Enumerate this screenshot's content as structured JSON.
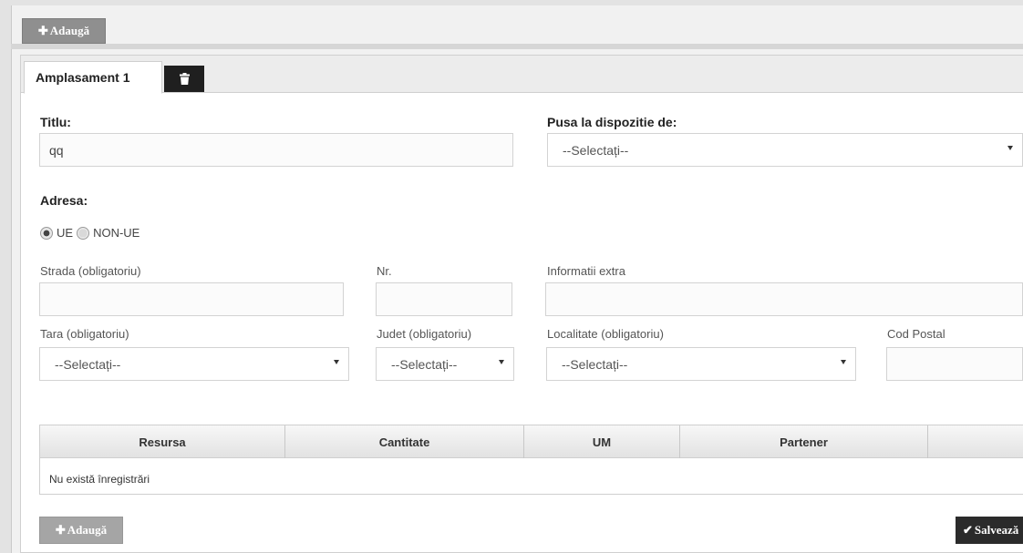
{
  "toolbar": {
    "add_label": "Adaugă"
  },
  "tabs": [
    {
      "label": "Amplasament 1"
    }
  ],
  "form": {
    "titlu_label": "Titlu:",
    "titlu_value": "qq",
    "pusa_label": "Pusa la dispozitie de:",
    "pusa_value": "--Selectați--",
    "adresa_label": "Adresa:",
    "radio_ue": "UE",
    "radio_nonue": "NON-UE",
    "radio_selected": "UE",
    "strada_label": "Strada (obligatoriu)",
    "nr_label": "Nr.",
    "info_label": "Informatii extra",
    "tara_label": "Tara (obligatoriu)",
    "tara_value": "--Selectați--",
    "judet_label": "Judet (obligatoriu)",
    "judet_value": "--Selectați--",
    "localitate_label": "Localitate (obligatoriu)",
    "localitate_value": "--Selectați--",
    "cod_label": "Cod Postal"
  },
  "table": {
    "columns": [
      "Resursa",
      "Cantitate",
      "UM",
      "Partener",
      ""
    ],
    "empty_text": "Nu există înregistrări"
  },
  "footer": {
    "add_label": "Adaugă",
    "save_label": "Salvează"
  },
  "icons": {
    "add": "plus-icon",
    "delete": "trash-icon",
    "save": "check-icon",
    "dropdown": "caret-down-icon"
  },
  "colors": {
    "save_button": "#2b2b2b",
    "add_button": "#8f8f8f"
  }
}
